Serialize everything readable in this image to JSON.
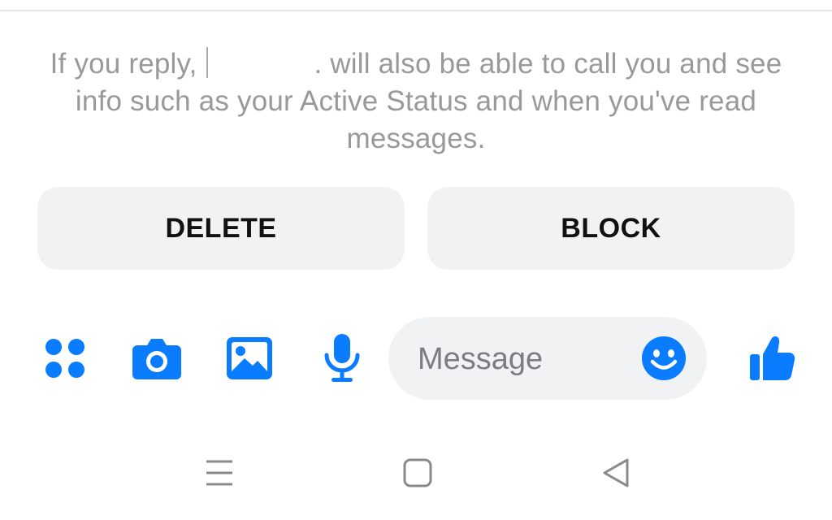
{
  "notice": {
    "text_before": "If you reply,",
    "text_after": ". will also be able to call you and see info such as your Active Status and when you've read messages."
  },
  "actions": {
    "delete_label": "DELETE",
    "block_label": "BLOCK"
  },
  "composer": {
    "placeholder": "Message",
    "icons": [
      "menu-grid-icon",
      "camera-icon",
      "gallery-icon",
      "microphone-icon",
      "emoji-icon",
      "thumbs-up-icon"
    ]
  },
  "nav": {
    "icons": [
      "recent-apps-icon",
      "home-icon",
      "back-icon"
    ]
  },
  "colors": {
    "accent": "#0a7cff",
    "button_bg": "#f1f2f4",
    "notice_text": "#999999",
    "nav_icon": "#8a8a8a"
  }
}
